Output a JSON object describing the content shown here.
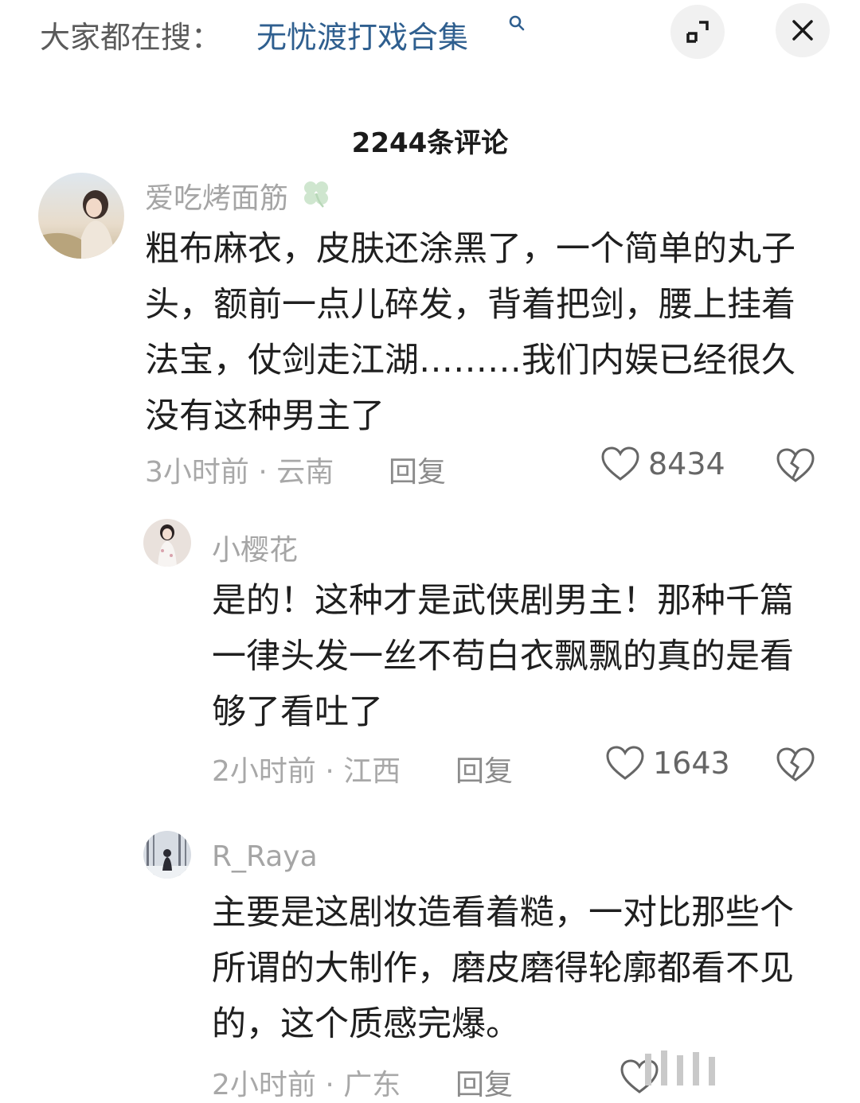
{
  "topbar": {
    "search_prefix": "大家都在搜：",
    "search_term": "无忧渡打戏合集"
  },
  "comment_count": "2244条评论",
  "comments": [
    {
      "username": "爱吃烤面筋",
      "body": "粗布麻衣，皮肤还涂黑了，一个简单的丸子头，额前一点儿碎发，背着把剑，腰上挂着法宝，仗剑走江湖………我们内娱已经很久没有这种男主了",
      "meta": "3小时前 · 云南",
      "reply": "回复",
      "likes": "8434"
    },
    {
      "username": "小樱花",
      "body": "是的！这种才是武侠剧男主！那种千篇一律头发一丝不苟白衣飘飘的真的是看够了看吐了",
      "meta": "2小时前 · 江西",
      "reply": "回复",
      "likes": "1643"
    },
    {
      "username": "R_Raya",
      "body": "主要是这剧妆造看着糙，一对比那些个所谓的大制作，磨皮磨得轮廓都看不见的，这个质感完爆。",
      "meta": "2小时前 · 广东",
      "reply": "回复"
    }
  ],
  "icons": {
    "search": "search-icon",
    "expand": "collapse-icon",
    "close": "close-icon",
    "like": "heart-icon",
    "dislike": "broken-heart-icon",
    "badge": "clover-icon"
  }
}
